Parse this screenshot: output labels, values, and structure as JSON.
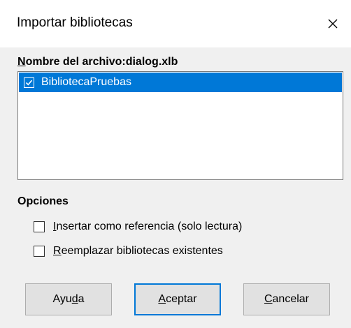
{
  "window": {
    "title": "Importar bibliotecas",
    "close_icon": "close-icon"
  },
  "file_section": {
    "label_prefix": "N",
    "label_rest": "ombre del archivo:dialog.xlb",
    "items": [
      {
        "label": "BibliotecaPruebas",
        "checked": true,
        "selected": true
      }
    ]
  },
  "options": {
    "label": "Opciones",
    "checkboxes": [
      {
        "accel": "I",
        "label_rest": "nsertar como referencia (solo lectura)",
        "checked": false
      },
      {
        "accel": "R",
        "label_rest": "eemplazar bibliotecas existentes",
        "checked": false
      }
    ]
  },
  "buttons": {
    "help_pre": "Ayu",
    "help_accel": "d",
    "help_post": "a",
    "ok_accel": "A",
    "ok_rest": "ceptar",
    "cancel_accel": "C",
    "cancel_rest": "ancelar"
  },
  "colors": {
    "selection": "#0078d7",
    "dialog_bg": "#f0f0f0",
    "titlebar_bg": "#ffffff"
  }
}
